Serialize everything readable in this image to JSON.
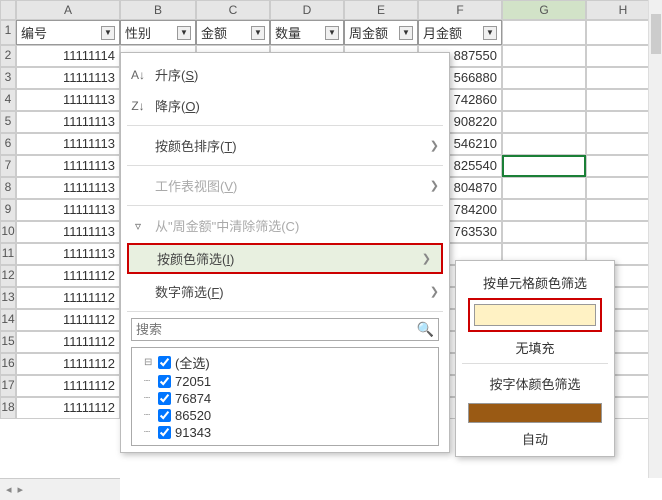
{
  "columns": [
    "A",
    "B",
    "C",
    "D",
    "E",
    "F",
    "G",
    "H"
  ],
  "row_numbers": [
    1,
    2,
    3,
    4,
    5,
    6,
    7,
    8,
    9,
    10,
    11,
    12,
    13,
    14,
    15,
    16,
    17,
    18
  ],
  "headers": {
    "A": "编号",
    "B": "性别",
    "C": "金额",
    "D": "数量",
    "E": "周金额",
    "F": "月金额"
  },
  "selected_col": "G",
  "active_row": 7,
  "colA": [
    "11111114",
    "11111113",
    "11111113",
    "11111113",
    "11111113",
    "11111113",
    "11111113",
    "11111113",
    "11111113",
    "11111113",
    "11111112",
    "11111112",
    "11111112",
    "11111112",
    "11111112",
    "11111112",
    "11111112"
  ],
  "colF": [
    "887550",
    "566880",
    "742860",
    "908220",
    "546210",
    "825540",
    "804870",
    "784200",
    "763530"
  ],
  "menu": {
    "sort_asc": "升序(S)",
    "sort_desc": "降序(O)",
    "sort_by_color": "按颜色排序(T)",
    "sheet_view": "工作表视图(V)",
    "clear_filter": "从\"周金额\"中清除筛选(C)",
    "filter_by_color": "按颜色筛选(I)",
    "number_filter": "数字筛选(F)",
    "search_ph": "搜索",
    "tree": [
      "(全选)",
      "72051",
      "76874",
      "86520",
      "91343"
    ]
  },
  "submenu": {
    "by_cell_color": "按单元格颜色筛选",
    "no_fill": "无填充",
    "by_font_color": "按字体颜色筛选",
    "auto": "自动"
  }
}
